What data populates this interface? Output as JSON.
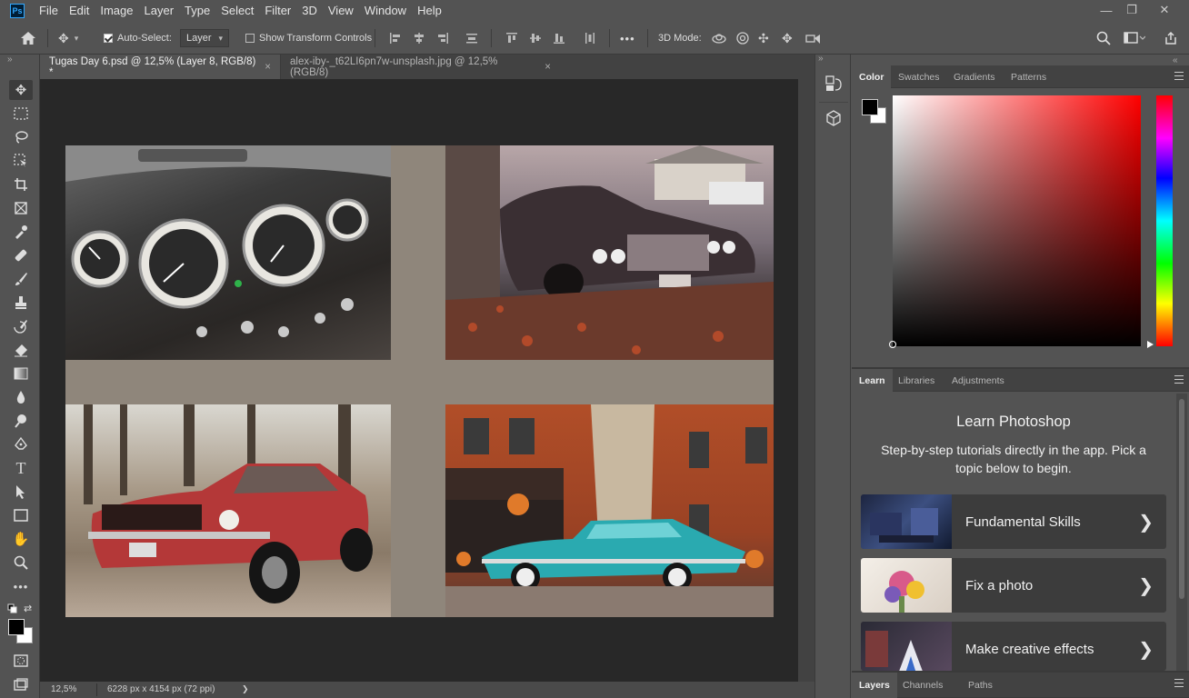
{
  "app": {
    "logo": "Ps"
  },
  "menu": [
    "File",
    "Edit",
    "Image",
    "Layer",
    "Type",
    "Select",
    "Filter",
    "3D",
    "View",
    "Window",
    "Help"
  ],
  "window_controls": {
    "minimize": "—",
    "restore": "❐",
    "close": "✕"
  },
  "options_bar": {
    "auto_select_label": "Auto-Select:",
    "auto_select_checked": true,
    "auto_select_target": "Layer",
    "transform_label": "Show Transform Controls",
    "transform_checked": false,
    "more": "•••",
    "mode_3d_label": "3D Mode:"
  },
  "document_tabs": [
    {
      "label": "Tugas Day 6.psd @ 12,5% (Layer 8, RGB/8) *",
      "active": true
    },
    {
      "label": "alex-iby-_t62LI6pn7w-unsplash.jpg @ 12,5% (RGB/8)",
      "active": false
    }
  ],
  "status_bar": {
    "zoom": "12,5%",
    "doc_info": "6228 px x 4154 px (72 ppi)",
    "arrow": "❯"
  },
  "color_panel": {
    "tabs": [
      "Color",
      "Swatches",
      "Gradients",
      "Patterns"
    ],
    "active_tab": "Color",
    "foreground": "#000000",
    "background": "#ffffff",
    "hue_color": "#ff0000"
  },
  "learn_panel": {
    "tabs": [
      "Learn",
      "Libraries",
      "Adjustments"
    ],
    "active_tab": "Learn",
    "title": "Learn Photoshop",
    "subtitle": "Step-by-step tutorials directly in the app. Pick a topic below to begin.",
    "cards": [
      {
        "label": "Fundamental Skills",
        "chevron": "❯"
      },
      {
        "label": "Fix a photo",
        "chevron": "❯"
      },
      {
        "label": "Make creative effects",
        "chevron": "❯"
      }
    ]
  },
  "layers_panel": {
    "tabs": [
      "Layers",
      "Channels",
      "Paths"
    ],
    "active_tab": "Layers"
  },
  "collapse_arrows": {
    "left": "«",
    "right": "»"
  }
}
